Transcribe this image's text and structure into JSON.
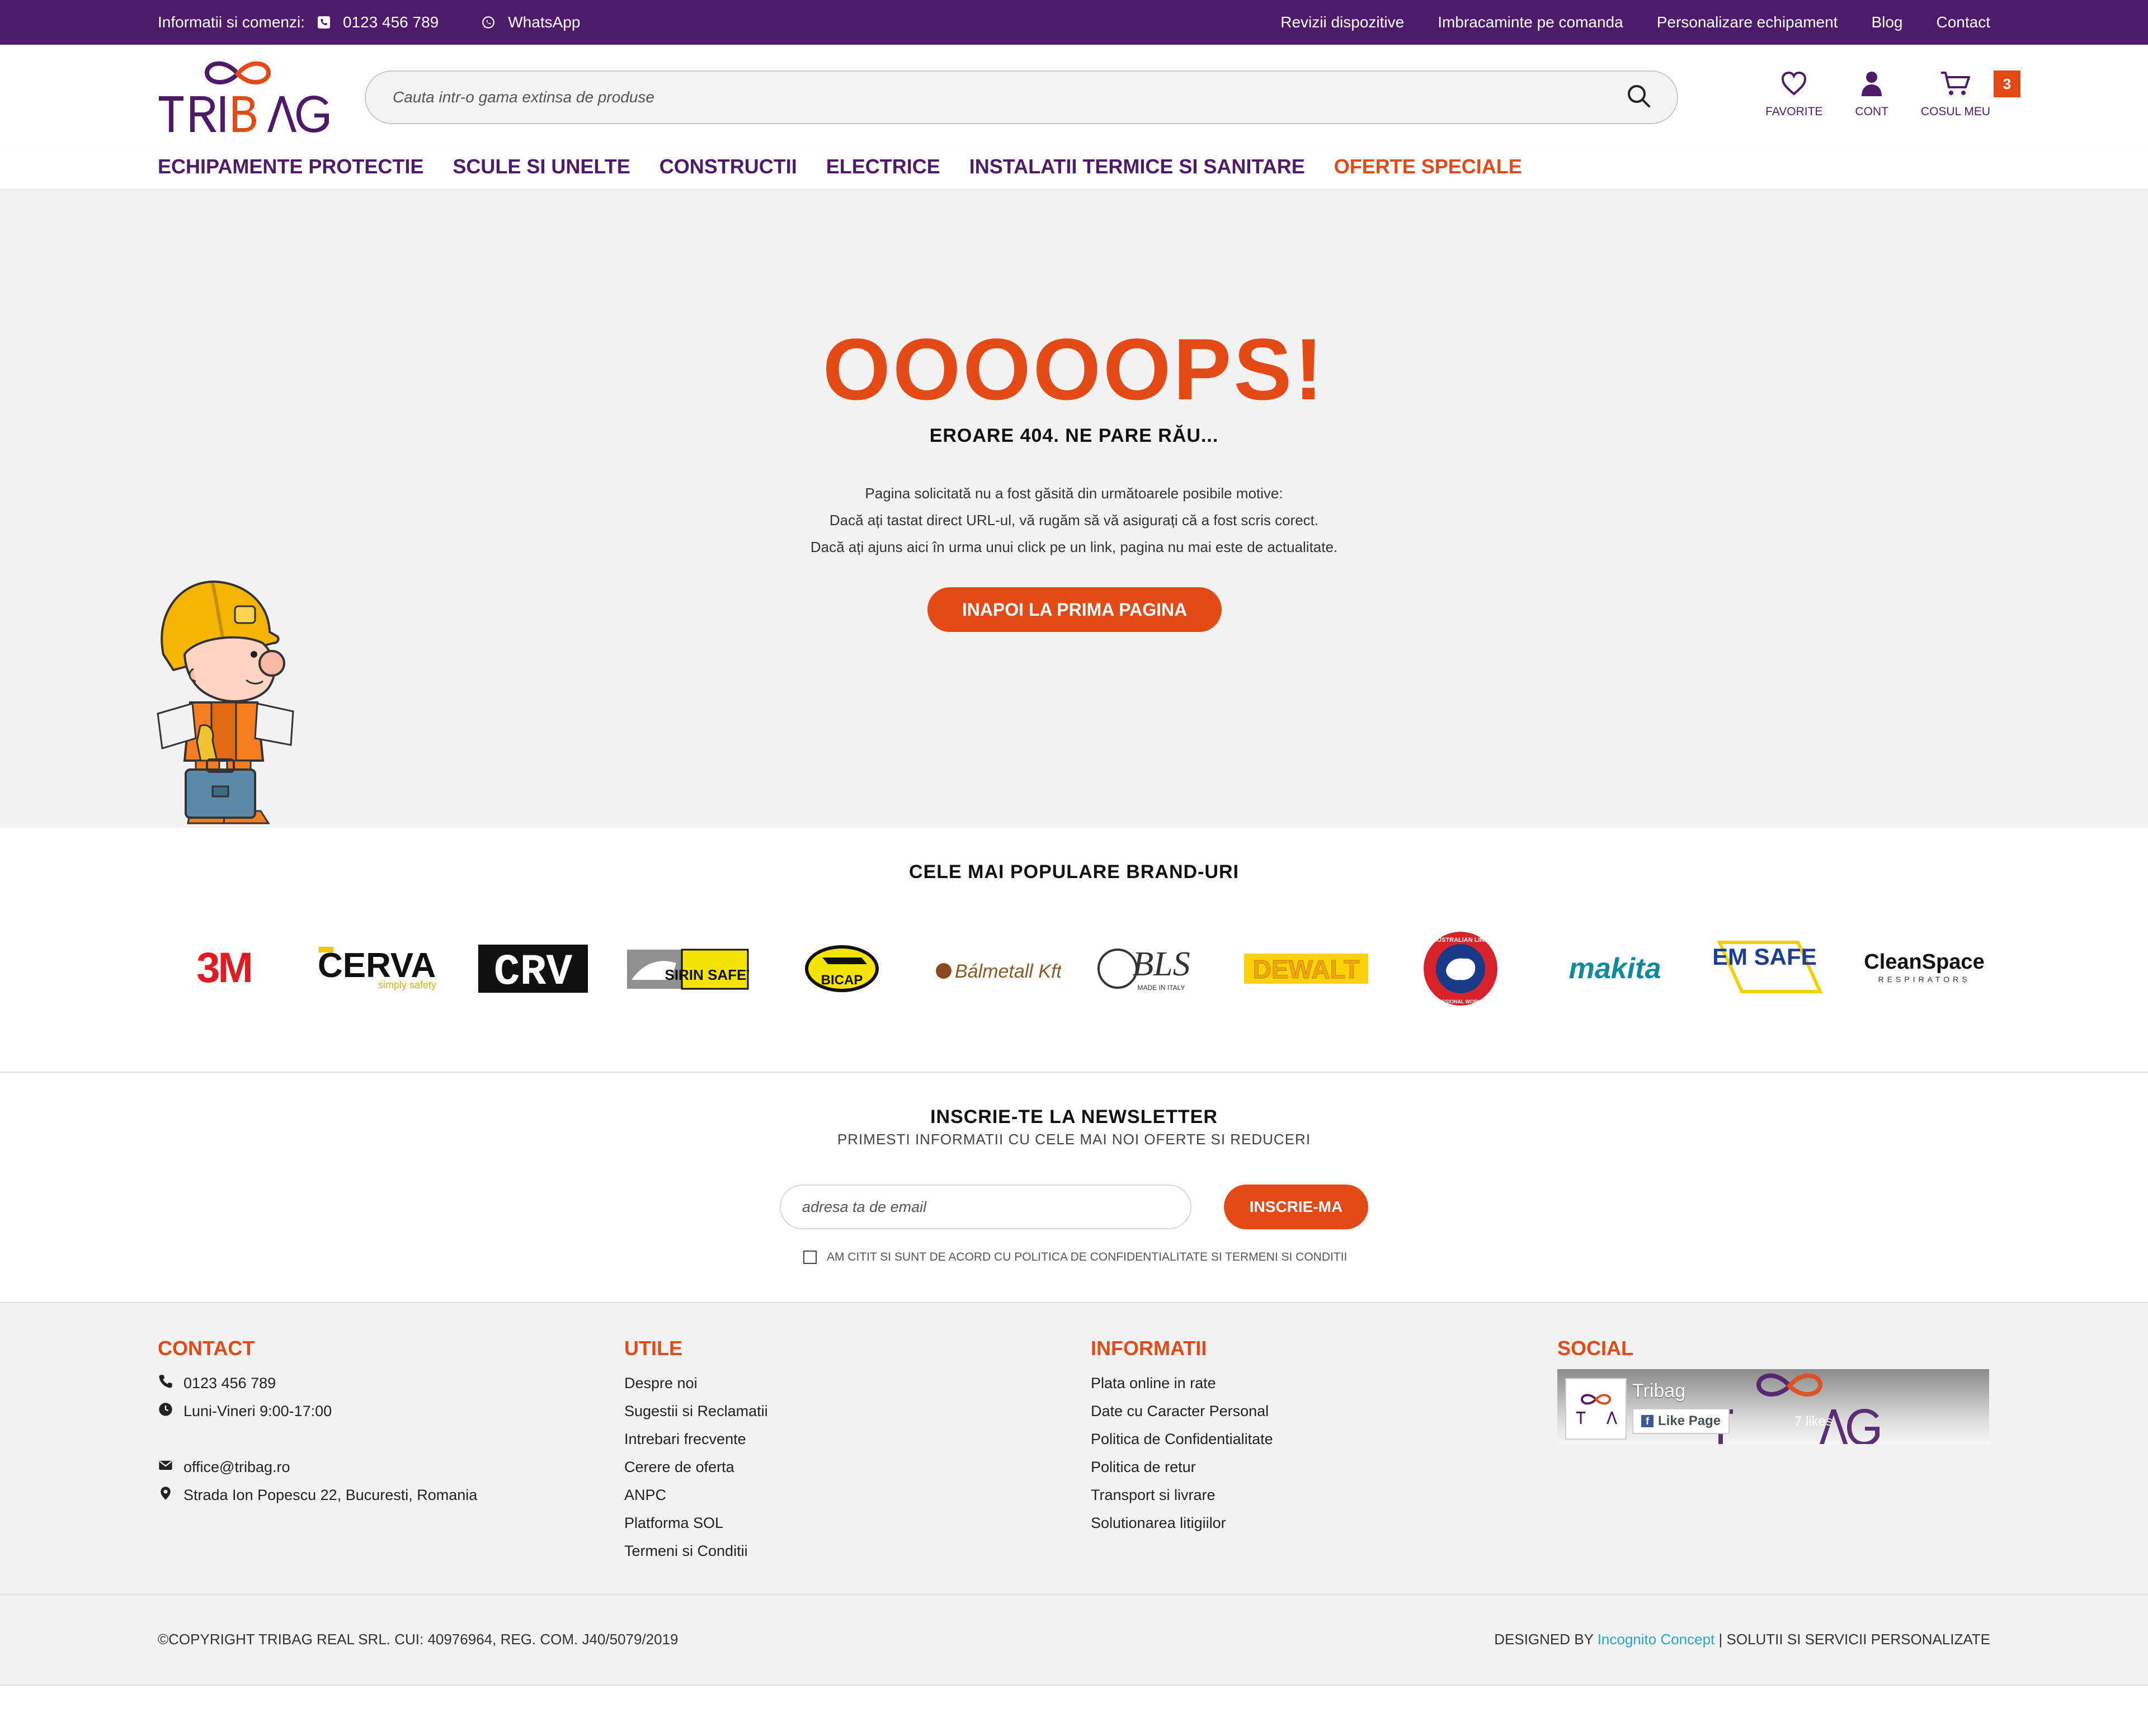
{
  "topbar": {
    "info_label": "Informatii si comenzi:",
    "phone": "0123 456 789",
    "whatsapp": "WhatsApp",
    "links": [
      "Revizii dispozitive",
      "Imbracaminte pe comanda",
      "Personalizare echipament",
      "Blog",
      "Contact"
    ]
  },
  "header": {
    "logo_text": "TRIBAG",
    "search_placeholder": "Cauta intr-o gama extinsa de produse",
    "favorites_label": "FAVORITE",
    "account_label": "CONT",
    "cart_label": "COSUL MEU",
    "cart_count": "3"
  },
  "nav": {
    "items": [
      "ECHIPAMENTE PROTECTIE",
      "SCULE SI UNELTE",
      "CONSTRUCTII",
      "ELECTRICE",
      "INSTALATII TERMICE SI SANITARE"
    ],
    "special": "OFERTE SPECIALE"
  },
  "error": {
    "title": "OOOOOPS!",
    "subtitle": "EROARE 404. NE PARE RĂU...",
    "lines": [
      "Pagina solicitată nu a fost găsită din următoarele posibile motive:",
      "Dacă ați tastat direct URL-ul, vă rugăm să vă asigurați că a fost scris corect.",
      "Dacă ați ajuns aici în urma unui click pe un link, pagina nu mai este de actualitate."
    ],
    "button": "INAPOI LA PRIMA PAGINA"
  },
  "brands": {
    "title": "CELE MAI POPULARE BRAND-URI",
    "items": [
      "3M",
      "CERVA",
      "CRV",
      "SIRIN SAFETY",
      "BICAP",
      "Bálmetall Kft.",
      "BLS",
      "DEWALT",
      "AUSTRALIAN LINE",
      "makita",
      "CHEM SAFE",
      "CleanSpace"
    ],
    "sublabels": {
      "cerva": "simply safety",
      "bls": "MADE IN ITALY",
      "cleanspace": "RESPIRATORS",
      "australian": "PROFESSIONAL WORKWEAR"
    }
  },
  "newsletter": {
    "title": "INSCRIE-TE LA NEWSLETTER",
    "subtitle": "PRIMESTI INFORMATII CU CELE MAI NOI OFERTE SI REDUCERI",
    "placeholder": "adresa ta de email",
    "button": "INSCRIE-MA",
    "agree": "AM CITIT SI SUNT DE ACORD CU POLITICA DE CONFIDENTIALITATE SI TERMENI SI CONDITII"
  },
  "footer": {
    "contact": {
      "title": "CONTACT",
      "phone": "0123 456 789",
      "hours": "Luni-Vineri 9:00-17:00",
      "email": "office@tribag.ro",
      "address": "Strada Ion Popescu 22, Bucuresti, Romania"
    },
    "utile": {
      "title": "UTILE",
      "items": [
        "Despre noi",
        "Sugestii si Reclamatii",
        "Intrebari frecvente",
        "Cerere de oferta",
        "ANPC",
        "Platforma SOL",
        "Termeni si Conditii"
      ]
    },
    "informatii": {
      "title": "INFORMATII",
      "items": [
        "Plata online in rate",
        "Date cu Caracter Personal",
        "Politica de Confidentialitate",
        "Politica de retur",
        "Transport si livrare",
        "Solutionarea litigiilor"
      ]
    },
    "social": {
      "title": "SOCIAL",
      "page_name": "Tribag",
      "like_label": "Like Page",
      "likes": "7 likes"
    }
  },
  "copyright": {
    "left": "©COPYRIGHT TRIBAG REAL SRL. CUI: 40976964, REG. COM. J40/5079/2019",
    "designed_by": "DESIGNED BY ",
    "designer": "Incognito Concept",
    "tail": " | SOLUTII SI SERVICII PERSONALIZATE"
  },
  "colors": {
    "purple": "#4e1b6b",
    "orange": "#e34a15",
    "link_blue": "#22a7c9"
  }
}
